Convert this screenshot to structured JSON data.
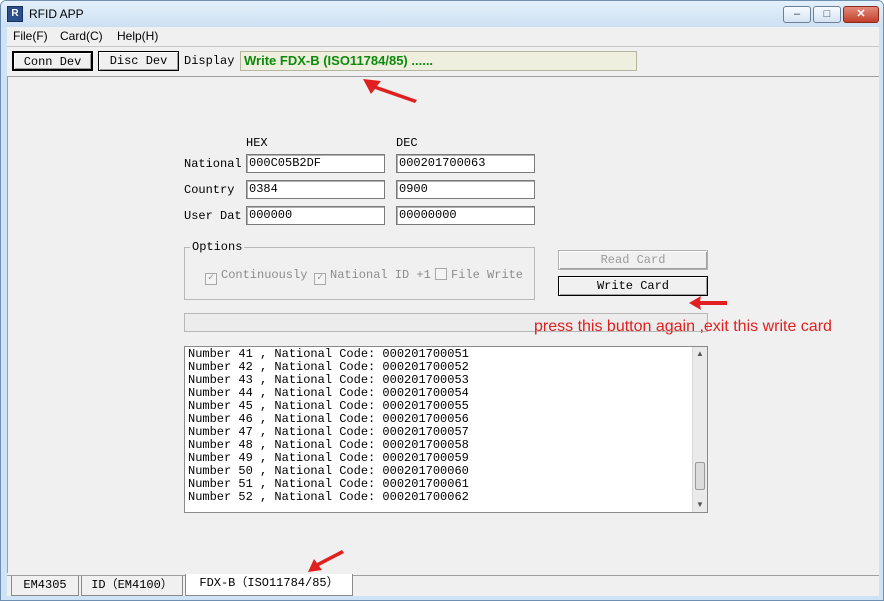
{
  "window": {
    "title": "RFID APP",
    "min": "–",
    "max": "□",
    "close": "✕"
  },
  "menu": [
    "File(F)",
    "Card(C)",
    "Help(H)"
  ],
  "toolbar": {
    "conn": "Conn Dev",
    "disc": "Disc Dev",
    "display_label": "Display",
    "display_value": "Write FDX-B (ISO11784/85) ......"
  },
  "form": {
    "hex_header": "HEX",
    "dec_header": "DEC",
    "rows": [
      {
        "label": "National",
        "hex": "000C05B2DF",
        "dec": "000201700063"
      },
      {
        "label": "Country",
        "hex": "0384",
        "dec": "0900"
      },
      {
        "label": "User Dat",
        "hex": "000000",
        "dec": "00000000"
      }
    ]
  },
  "options": {
    "title": "Options",
    "items": [
      {
        "label": "Continuously",
        "checked": true
      },
      {
        "label": "National ID +1",
        "checked": true
      },
      {
        "label": "File Write",
        "checked": false
      }
    ]
  },
  "buttons": {
    "read": "Read Card",
    "write": "Write Card"
  },
  "annotation": "press this button again ,exit this write card",
  "log": [
    "Number 41 , National Code: 000201700051",
    "Number 42 , National Code: 000201700052",
    "Number 43 , National Code: 000201700053",
    "Number 44 , National Code: 000201700054",
    "Number 45 , National Code: 000201700055",
    "Number 46 , National Code: 000201700056",
    "Number 47 , National Code: 000201700057",
    "Number 48 , National Code: 000201700058",
    "Number 49 , National Code: 000201700059",
    "Number 50 , National Code: 000201700060",
    "Number 51 , National Code: 000201700061",
    "Number 52 , National Code: 000201700062"
  ],
  "tabs": [
    "EM4305",
    "ID（EM4100）",
    "FDX-B（ISO11784/85）"
  ],
  "colors": {
    "display_text": "#0c8a0c",
    "annotation": "#e02020",
    "arrow": "#e02020"
  }
}
